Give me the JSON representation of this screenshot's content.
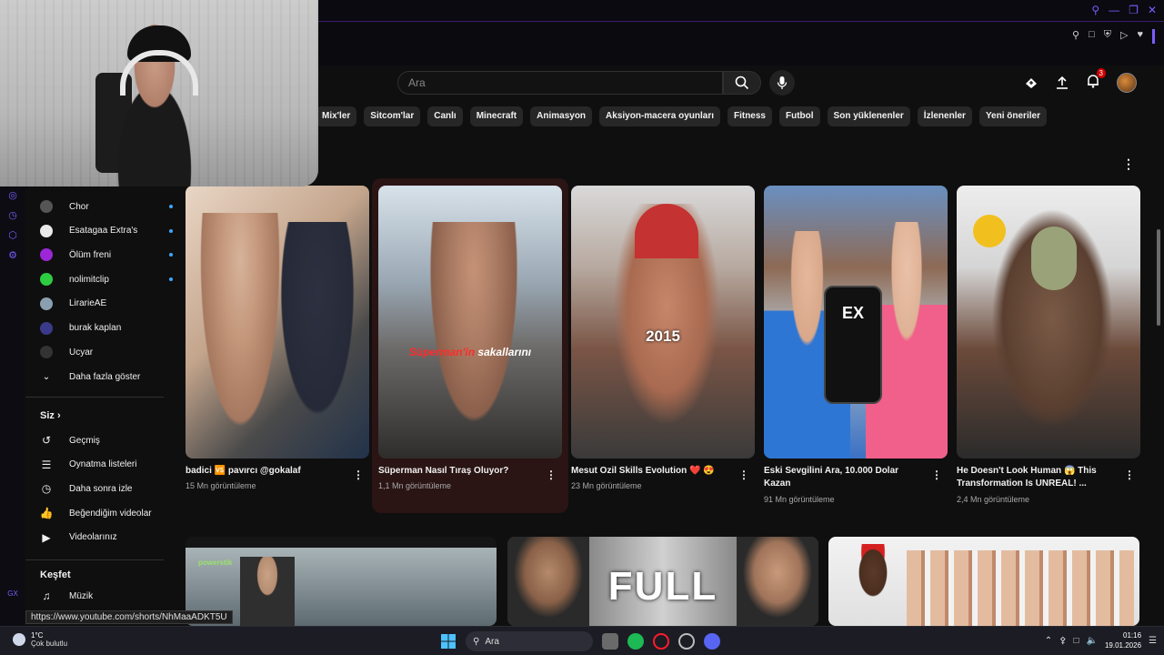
{
  "browser": {
    "title_icons": [
      "search-icon",
      "minimize-icon",
      "restore-icon",
      "close-icon"
    ]
  },
  "header": {
    "search_placeholder": "Ara",
    "notifications_count": "3"
  },
  "chips": [
    "Mix'ler",
    "Sitcom'lar",
    "Canlı",
    "Minecraft",
    "Animasyon",
    "Aksiyon-macera oyunları",
    "Fitness",
    "Futbol",
    "Son yüklenenler",
    "İzlenenler",
    "Yeni öneriler"
  ],
  "sidebar": {
    "subscriptions": [
      {
        "name": "Chor",
        "color": "#555555"
      },
      {
        "name": "Esatagaa Extra's",
        "color": "#e9e9e9"
      },
      {
        "name": "Ölüm freni",
        "color": "#9b27d6"
      },
      {
        "name": "nolimitclip",
        "color": "#2ecc40"
      },
      {
        "name": "LirarieAE",
        "color": "#8aa0b0"
      },
      {
        "name": "burak kaplan",
        "color": "#3a3a8a"
      },
      {
        "name": "Ucyar",
        "color": "#333333"
      }
    ],
    "show_more": "Daha fazla göster",
    "you_title": "Siz",
    "you_items": [
      {
        "label": "Geçmiş",
        "icon": "history-icon"
      },
      {
        "label": "Oynatma listeleri",
        "icon": "playlist-icon"
      },
      {
        "label": "Daha sonra izle",
        "icon": "clock-icon"
      },
      {
        "label": "Beğendiğim videolar",
        "icon": "like-icon"
      },
      {
        "label": "Videolarınız",
        "icon": "video-icon"
      }
    ],
    "explore_title": "Keşfet",
    "explore_items": [
      {
        "label": "Müzik",
        "icon": "music-icon"
      }
    ]
  },
  "shorts": [
    {
      "title": "badici 🆚 pavırcı @gokalaf",
      "views": "15 Mn görüntüleme"
    },
    {
      "title": "Süperman Nasıl Tıraş Oluyor?",
      "views": "1,1 Mn görüntüleme",
      "overlay": "Süperman'in sakallarını"
    },
    {
      "title": "Mesut Ozil Skills Evolution ❤️ 😍",
      "views": "23 Mn görüntüleme",
      "overlay": "2015"
    },
    {
      "title": "Eski Sevgilini Ara, 10.000 Dolar Kazan",
      "views": "91 Mn görüntüleme",
      "overlay": "EX"
    },
    {
      "title": "He Doesn't Look Human 😱 This Transformation Is UNREAL! ...",
      "views": "2,4 Mn görüntüleme"
    }
  ],
  "row2": {
    "thumb1_text": "powerstik",
    "thumb2_text": "FULL"
  },
  "status_url": "https://www.youtube.com/shorts/NhMaaADKT5U",
  "taskbar": {
    "temp": "1°C",
    "weather": "Çok bulutlu",
    "search": "Ara",
    "time": "01:16",
    "date": "19.01.2026"
  },
  "rail_text": "GX"
}
